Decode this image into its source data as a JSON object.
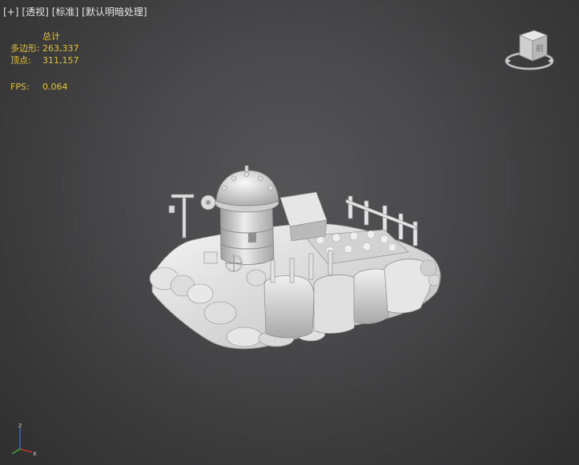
{
  "viewport": {
    "labels": [
      "[+]",
      "[透视]",
      "[标准]",
      "[默认明暗处理]"
    ]
  },
  "stats": {
    "header": "总计",
    "polygons_label": "多边形:",
    "polygons_value": "263,337",
    "vertices_label": "顶点:",
    "vertices_value": "311,157",
    "fps_label": "FPS:",
    "fps_value": "0.064"
  },
  "viewcube": {
    "face_label": "前"
  },
  "axis": {
    "z": "z",
    "x": "x",
    "colors": {
      "x": "#d23a2a",
      "y": "#3ab03a",
      "z": "#3a6ad2"
    }
  },
  "model": {
    "icon": "stylized-house-on-rock-mesh",
    "color": "#f0f0f0"
  }
}
